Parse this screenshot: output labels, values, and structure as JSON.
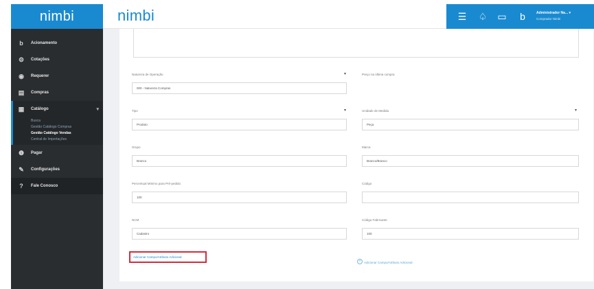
{
  "app": {
    "logo": "nimbi",
    "brand": "nimbi"
  },
  "header": {
    "user_name": "Administrador Na... ▾",
    "user_sub": "Comprador Nimbi",
    "icons": [
      "menu-icon",
      "bell-icon",
      "chat-icon",
      "brand-b-icon"
    ]
  },
  "sidebar": {
    "items": [
      {
        "icon": "b",
        "label": "Acionamento"
      },
      {
        "icon": "⚙",
        "label": "Cotações"
      },
      {
        "icon": "◉",
        "label": "Requerer"
      },
      {
        "icon": "▤",
        "label": "Compras"
      },
      {
        "icon": "▦",
        "label": "Catálogo"
      },
      {
        "icon": "❶",
        "label": "Pagar"
      },
      {
        "icon": "✎",
        "label": "Configurações"
      },
      {
        "icon": "?",
        "label": "Fale Conosco"
      }
    ],
    "submenu": [
      "Busca",
      "Gestão Catálogo Compras",
      "Gestão Catálogo Vendas",
      "Central de Importações"
    ]
  },
  "form": {
    "fields": [
      {
        "label": "Natureza de Operação",
        "value": "000 - Natureza Compras"
      },
      {
        "label": "Preço na última compra",
        "value": ""
      },
      {
        "label": "Tipo",
        "value": "Produto"
      },
      {
        "label": "Unidade de Medida",
        "value": "Peça"
      },
      {
        "label": "Grupo",
        "value": "Branco"
      },
      {
        "label": "Marca",
        "value": "Branco/Branco"
      },
      {
        "label": "Percentual Mínimo para Pré-pedido",
        "value": "100"
      },
      {
        "label": "Código",
        "value": ""
      },
      {
        "label": "NCM",
        "value": "Cadastro"
      },
      {
        "label": "Código Fabricante",
        "value": "100"
      }
    ],
    "add_left": "Adicionar Campo/Atributo Adicional",
    "add_right": "Adicionar Campo/Atributo Adicional"
  }
}
